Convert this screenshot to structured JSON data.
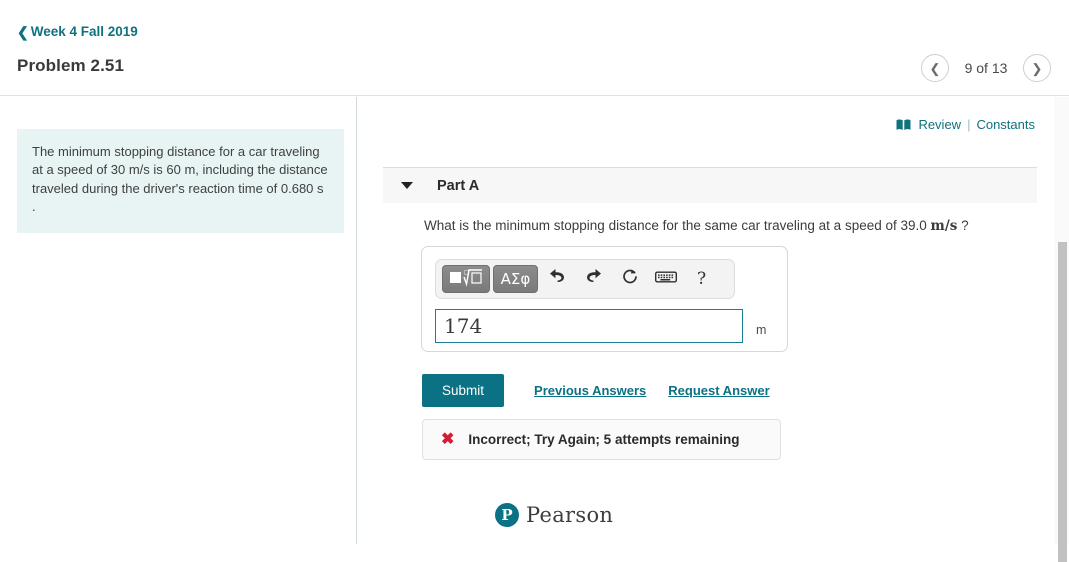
{
  "header": {
    "breadcrumb_label": "Week 4 Fall 2019",
    "back_icon": "chevron-left-icon",
    "page_title": "Problem 2.51",
    "accent_color": "#10717f",
    "title_color": "#3a3a3a"
  },
  "pager": {
    "prev_icon": "chevron-left-icon",
    "next_icon": "chevron-right-icon",
    "label": "9 of 13",
    "current": 9,
    "total": 13
  },
  "problem": {
    "statement": "The minimum stopping distance for a car traveling at a speed of 30 m/s is 60 m, including the distance traveled during the driver's reaction time of 0.680 s .",
    "background_color": "#e8f4f3"
  },
  "review": {
    "book_icon": "book-icon",
    "review_label": "Review",
    "separator": "|",
    "constants_label": "Constants",
    "color": "#10717f"
  },
  "part": {
    "caret_icon": "caret-down-icon",
    "label": "Part A",
    "question_prefix": "What is the minimum stopping distance for the same car traveling at a speed of 39.0",
    "question_unit": "m/s",
    "question_suffix": "?"
  },
  "toolbar": {
    "template_button": {
      "icon": "math-template-icon",
      "label": ""
    },
    "greek_button": {
      "icon": "greek-symbols-icon",
      "label": "ΑΣφ"
    },
    "undo_icon": "undo-arrow-icon",
    "redo_icon": "redo-arrow-icon",
    "reset_icon": "reset-circular-arrow-icon",
    "keyboard_icon": "keyboard-icon",
    "help_icon": "question-mark-icon",
    "help_label": "?"
  },
  "answer": {
    "value": "174",
    "placeholder": "",
    "unit": "m",
    "border_color": "#1a7f92"
  },
  "actions": {
    "submit_label": "Submit",
    "submit_color": "#0b7285",
    "previous_answers_label": "Previous Answers",
    "request_answer_label": "Request Answer"
  },
  "feedback": {
    "icon": "x-mark-icon",
    "icon_glyph": "✖",
    "icon_color": "#d81b32",
    "message": "Incorrect; Try Again; 5 attempts remaining"
  },
  "footer": {
    "logo_mark": "P",
    "logo_text": "Pearson",
    "logo_color": "#0b7285"
  }
}
